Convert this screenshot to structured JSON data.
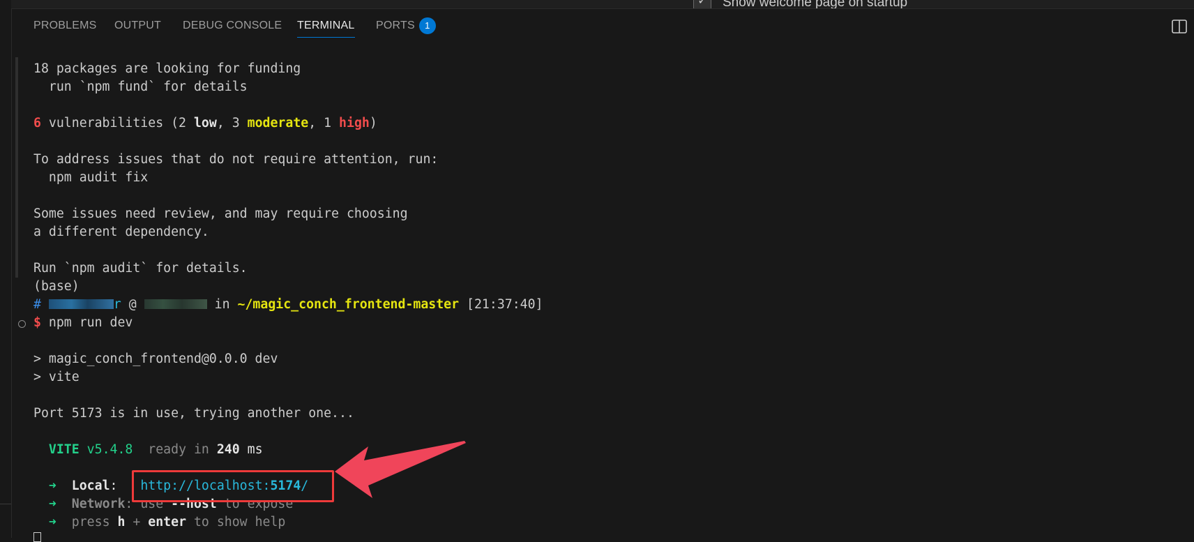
{
  "top_peek": {
    "welcome_label": "Show welcome page on startup"
  },
  "panel": {
    "tabs": [
      {
        "label": "PROBLEMS"
      },
      {
        "label": "OUTPUT"
      },
      {
        "label": "DEBUG CONSOLE"
      },
      {
        "label": "TERMINAL"
      },
      {
        "label": "PORTS"
      }
    ],
    "active_tab": "TERMINAL",
    "ports_badge": "1"
  },
  "terminal": {
    "l1": "18 packages are looking for funding",
    "l2": "  run `npm fund` for details",
    "vuln_count": "6",
    "vuln_text": " vulnerabilities (2 ",
    "vuln_low": "low",
    "vuln_mid": ", 3 ",
    "vuln_moderate": "moderate",
    "vuln_sep": ", 1 ",
    "vuln_high": "high",
    "vuln_close": ")",
    "l4": "To address issues that do not require attention, run:",
    "l5": "  npm audit fix",
    "l6": "Some issues need review, and may require choosing",
    "l7": "a different dependency.",
    "l8": "Run `npm audit` for details.",
    "l9": "(base)",
    "prompt_hash": "#",
    "prompt_user_tail": "r",
    "prompt_at": " @ ",
    "prompt_in": " in ",
    "prompt_dir": "~/magic_conch_frontend-master",
    "prompt_time": " [21:37:40]",
    "prompt_dollar": "$",
    "command": " npm run dev",
    "out1": "> magic_conch_frontend@0.0.0 dev",
    "out2": "> vite",
    "out3": "Port 5173 is in use, trying another one...",
    "vite_name": "VITE",
    "vite_version": " v5.4.8",
    "vite_ready": "  ready in ",
    "vite_ms": "240",
    "vite_ms_unit": " ms",
    "arrow_glyph": "➜",
    "local_label": "Local",
    "local_colon": ":",
    "local_url_pre": "http://localhost:",
    "local_url_port": "5174",
    "local_url_post": "/",
    "network_label": "Network",
    "network_text": ": use ",
    "network_flag": "--host",
    "network_tail": " to expose",
    "help_text": "press ",
    "help_h": "h",
    "help_plus": " + ",
    "help_enter": "enter",
    "help_tail": " to show help"
  },
  "colors": {
    "background": "#181818",
    "accent": "#0078d4",
    "annotation_red": "#ee3a3a"
  }
}
